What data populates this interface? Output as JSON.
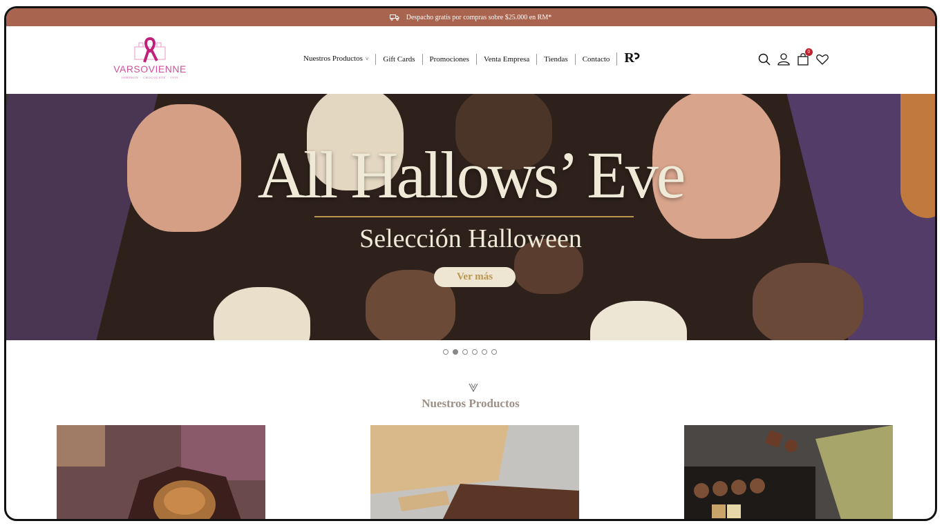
{
  "promo": {
    "text": "Despacho gratis por compras sobre $25.000 en RM*",
    "icon": "truck-icon"
  },
  "logo": {
    "brand": "VARSOVIENNE",
    "tagline": "JOHNSON · CHOCOLATE · 1959"
  },
  "nav": {
    "items": [
      "Nuestros Productos",
      "Gift Cards",
      "Promociones",
      "Venta Empresa",
      "Tiendas",
      "Contacto"
    ],
    "rb": "R"
  },
  "header_icons": {
    "cart_count": "0",
    "names": [
      "search-icon",
      "user-icon",
      "cart-icon",
      "heart-icon"
    ]
  },
  "hero": {
    "title": "All Hallows’ Eve",
    "subtitle": "Selección Halloween",
    "button": "Ver más",
    "slides": 6,
    "active_slide": 2
  },
  "section": {
    "title": "Nuestros Productos"
  },
  "colors": {
    "promo_bar": "#a9644f",
    "brand_pink": "#d0509a",
    "gold": "#b8954e",
    "cream": "#efe9d7"
  }
}
